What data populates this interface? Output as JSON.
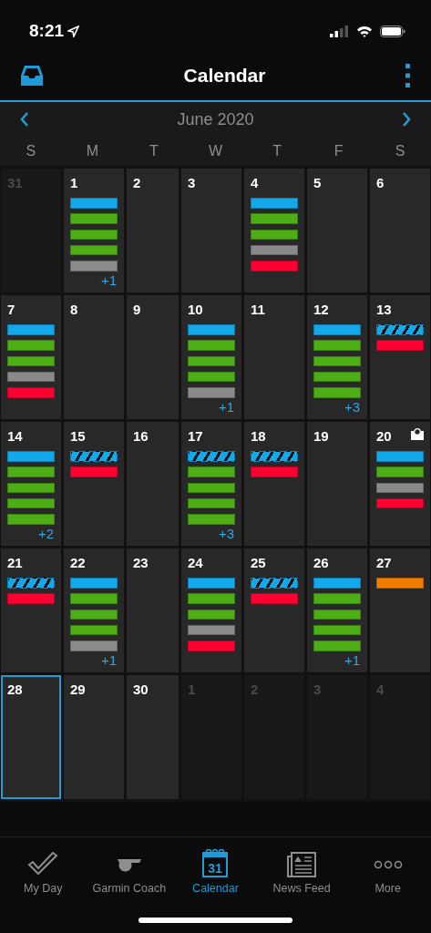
{
  "status_bar": {
    "time": "8:21"
  },
  "header": {
    "title": "Calendar"
  },
  "month": {
    "title": "June 2020"
  },
  "weekdays": [
    "S",
    "M",
    "T",
    "W",
    "T",
    "F",
    "S"
  ],
  "weeks": [
    [
      {
        "day": "31",
        "outside": true,
        "selected": false
      },
      {
        "day": "1",
        "outside": false,
        "selected": false,
        "events": [
          {
            "kind": "bar",
            "color": "#12a8ea"
          },
          {
            "kind": "bar",
            "color": "#4dad14"
          },
          {
            "kind": "bar",
            "color": "#4dad14"
          },
          {
            "kind": "bar",
            "color": "#4dad14"
          },
          {
            "kind": "bar",
            "color": "#8a8a8a"
          }
        ],
        "more": "+1"
      },
      {
        "day": "2",
        "outside": false,
        "selected": false
      },
      {
        "day": "3",
        "outside": false,
        "selected": false
      },
      {
        "day": "4",
        "outside": false,
        "selected": false,
        "events": [
          {
            "kind": "bar",
            "color": "#12a8ea"
          },
          {
            "kind": "bar",
            "color": "#4dad14"
          },
          {
            "kind": "bar",
            "color": "#4dad14"
          },
          {
            "kind": "bar",
            "color": "#8a8a8a"
          },
          {
            "kind": "bar",
            "color": "#ff0033"
          }
        ]
      },
      {
        "day": "5",
        "outside": false,
        "selected": false
      },
      {
        "day": "6",
        "outside": false,
        "selected": false
      }
    ],
    [
      {
        "day": "7",
        "outside": false,
        "selected": false,
        "events": [
          {
            "kind": "bar",
            "color": "#12a8ea"
          },
          {
            "kind": "bar",
            "color": "#4dad14"
          },
          {
            "kind": "bar",
            "color": "#4dad14"
          },
          {
            "kind": "bar",
            "color": "#8a8a8a"
          },
          {
            "kind": "bar",
            "color": "#ff0033"
          }
        ]
      },
      {
        "day": "8",
        "outside": false,
        "selected": false
      },
      {
        "day": "9",
        "outside": false,
        "selected": false
      },
      {
        "day": "10",
        "outside": false,
        "selected": false,
        "events": [
          {
            "kind": "bar",
            "color": "#12a8ea"
          },
          {
            "kind": "bar",
            "color": "#4dad14"
          },
          {
            "kind": "bar",
            "color": "#4dad14"
          },
          {
            "kind": "bar",
            "color": "#4dad14"
          },
          {
            "kind": "bar",
            "color": "#8a8a8a"
          }
        ],
        "more": "+1"
      },
      {
        "day": "11",
        "outside": false,
        "selected": false
      },
      {
        "day": "12",
        "outside": false,
        "selected": false,
        "events": [
          {
            "kind": "bar",
            "color": "#12a8ea"
          },
          {
            "kind": "bar",
            "color": "#4dad14"
          },
          {
            "kind": "bar",
            "color": "#4dad14"
          },
          {
            "kind": "bar",
            "color": "#4dad14"
          },
          {
            "kind": "bar",
            "color": "#4dad14"
          }
        ],
        "more": "+3"
      },
      {
        "day": "13",
        "outside": false,
        "selected": false,
        "events": [
          {
            "kind": "striped",
            "color": "#12a8ea"
          },
          {
            "kind": "bar",
            "color": "#ff0033"
          }
        ]
      }
    ],
    [
      {
        "day": "14",
        "outside": false,
        "selected": false,
        "events": [
          {
            "kind": "bar",
            "color": "#12a8ea"
          },
          {
            "kind": "bar",
            "color": "#4dad14"
          },
          {
            "kind": "bar",
            "color": "#4dad14"
          },
          {
            "kind": "bar",
            "color": "#4dad14"
          },
          {
            "kind": "bar",
            "color": "#4dad14"
          }
        ],
        "more": "+2"
      },
      {
        "day": "15",
        "outside": false,
        "selected": false,
        "events": [
          {
            "kind": "striped",
            "color": "#12a8ea"
          },
          {
            "kind": "bar",
            "color": "#ff0033"
          }
        ]
      },
      {
        "day": "16",
        "outside": false,
        "selected": false
      },
      {
        "day": "17",
        "outside": false,
        "selected": false,
        "events": [
          {
            "kind": "striped",
            "color": "#12a8ea"
          },
          {
            "kind": "bar",
            "color": "#4dad14"
          },
          {
            "kind": "bar",
            "color": "#4dad14"
          },
          {
            "kind": "bar",
            "color": "#4dad14"
          },
          {
            "kind": "bar",
            "color": "#4dad14"
          }
        ],
        "more": "+3"
      },
      {
        "day": "18",
        "outside": false,
        "selected": false,
        "events": [
          {
            "kind": "striped",
            "color": "#12a8ea"
          },
          {
            "kind": "bar",
            "color": "#ff0033"
          }
        ]
      },
      {
        "day": "19",
        "outside": false,
        "selected": false
      },
      {
        "day": "20",
        "outside": false,
        "selected": false,
        "has_icon": true,
        "events": [
          {
            "kind": "bar",
            "color": "#12a8ea"
          },
          {
            "kind": "bar",
            "color": "#4dad14"
          },
          {
            "kind": "bar",
            "color": "#8a8a8a"
          },
          {
            "kind": "bar",
            "color": "#ff0033"
          }
        ]
      }
    ],
    [
      {
        "day": "21",
        "outside": false,
        "selected": false,
        "events": [
          {
            "kind": "striped",
            "color": "#12a8ea"
          },
          {
            "kind": "bar",
            "color": "#ff0033"
          }
        ]
      },
      {
        "day": "22",
        "outside": false,
        "selected": false,
        "events": [
          {
            "kind": "bar",
            "color": "#12a8ea"
          },
          {
            "kind": "bar",
            "color": "#4dad14"
          },
          {
            "kind": "bar",
            "color": "#4dad14"
          },
          {
            "kind": "bar",
            "color": "#4dad14"
          },
          {
            "kind": "bar",
            "color": "#8a8a8a"
          }
        ],
        "more": "+1"
      },
      {
        "day": "23",
        "outside": false,
        "selected": false
      },
      {
        "day": "24",
        "outside": false,
        "selected": false,
        "events": [
          {
            "kind": "bar",
            "color": "#12a8ea"
          },
          {
            "kind": "bar",
            "color": "#4dad14"
          },
          {
            "kind": "bar",
            "color": "#4dad14"
          },
          {
            "kind": "bar",
            "color": "#8a8a8a"
          },
          {
            "kind": "bar",
            "color": "#ff0033"
          }
        ]
      },
      {
        "day": "25",
        "outside": false,
        "selected": false,
        "events": [
          {
            "kind": "striped",
            "color": "#12a8ea"
          },
          {
            "kind": "bar",
            "color": "#ff0033"
          }
        ]
      },
      {
        "day": "26",
        "outside": false,
        "selected": false,
        "events": [
          {
            "kind": "bar",
            "color": "#12a8ea"
          },
          {
            "kind": "bar",
            "color": "#4dad14"
          },
          {
            "kind": "bar",
            "color": "#4dad14"
          },
          {
            "kind": "bar",
            "color": "#4dad14"
          },
          {
            "kind": "bar",
            "color": "#4dad14"
          }
        ],
        "more": "+1"
      },
      {
        "day": "27",
        "outside": false,
        "selected": false,
        "events": [
          {
            "kind": "bar",
            "color": "#f07d00"
          }
        ]
      }
    ],
    [
      {
        "day": "28",
        "outside": false,
        "selected": true
      },
      {
        "day": "29",
        "outside": false,
        "selected": false
      },
      {
        "day": "30",
        "outside": false,
        "selected": false
      },
      {
        "day": "1",
        "outside": true,
        "selected": false
      },
      {
        "day": "2",
        "outside": true,
        "selected": false
      },
      {
        "day": "3",
        "outside": true,
        "selected": false
      },
      {
        "day": "4",
        "outside": true,
        "selected": false
      }
    ]
  ],
  "tabs": [
    {
      "kind": "check",
      "label": "My Day",
      "selected": false
    },
    {
      "kind": "whistle",
      "label": "Garmin Coach",
      "selected": false
    },
    {
      "kind": "calendar",
      "label": "Calendar",
      "icon_text": "31",
      "selected": true
    },
    {
      "kind": "news",
      "label": "News Feed",
      "selected": false
    },
    {
      "kind": "more",
      "label": "More",
      "selected": false
    }
  ]
}
